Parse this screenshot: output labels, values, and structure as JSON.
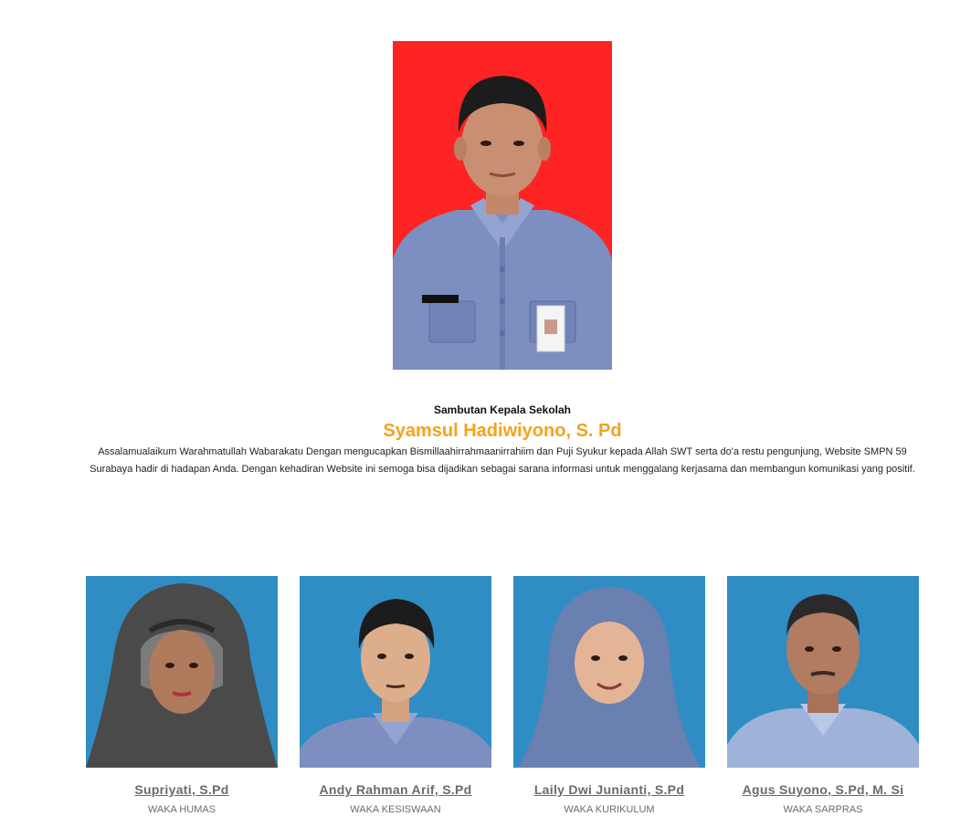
{
  "principal": {
    "photo_icon": "principal-portrait-icon",
    "name_tag": "SYAMSUL HADIWIYONO",
    "label": "Sambutan Kepala Sekolah",
    "name": "Syamsul Hadiwiyono, S. Pd",
    "message": "Assalamualaikum Warahmatullah Wabarakatu Dengan mengucapkan Bismillaahirrahmaanirrahiim dan Puji Syukur kepada Allah SWT serta do'a restu pengunjung, Website SMPN 59 Surabaya hadir di hadapan Anda. Dengan kehadiran Website ini semoga bisa dijadikan sebagai sarana informasi untuk menggalang kerjasama dan membangun komunikasi yang positif."
  },
  "staff": [
    {
      "name": "Supriyati, S.Pd",
      "role": "WAKA HUMAS",
      "photo_icon": "staff-portrait-icon"
    },
    {
      "name": "Andy Rahman Arif, S.Pd",
      "role": "WAKA KESISWAAN",
      "photo_icon": "staff-portrait-icon"
    },
    {
      "name": "Laily Dwi Junianti, S.Pd",
      "role": "WAKA KURIKULUM",
      "photo_icon": "staff-portrait-icon"
    },
    {
      "name": "Agus Suyono, S.Pd, M. Si",
      "role": "WAKA SARPRAS",
      "photo_icon": "staff-portrait-icon"
    }
  ],
  "colors": {
    "principal_bg": "#ff2424",
    "staff_bg": "#2f8dc3",
    "accent_name": "#f5a21b",
    "uniform": "#7d8fc0"
  }
}
